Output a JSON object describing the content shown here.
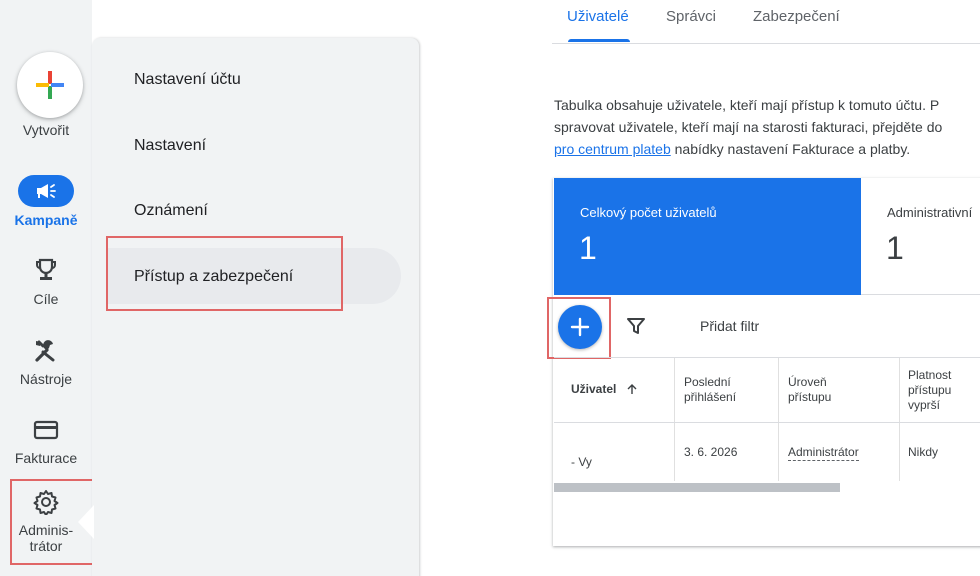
{
  "nav": {
    "create_label": "Vytvořit",
    "items": [
      {
        "label": "Kampaně",
        "icon": "megaphone-icon",
        "active": true
      },
      {
        "label": "Cíle",
        "icon": "trophy-icon"
      },
      {
        "label": "Nástroje",
        "icon": "tools-icon"
      },
      {
        "label": "Fakturace",
        "icon": "credit-card-icon"
      },
      {
        "label": "Adminis-\ntrátor",
        "icon": "gear-icon"
      }
    ]
  },
  "settings_menu": {
    "items": [
      {
        "label": "Nastavení účtu"
      },
      {
        "label": "Nastavení"
      },
      {
        "label": "Oznámení"
      },
      {
        "label": "Přístup a zabezpečení",
        "active": true
      }
    ]
  },
  "tabs": [
    {
      "label": "Uživatelé",
      "active": true
    },
    {
      "label": "Správci"
    },
    {
      "label": "Zabezpečení"
    }
  ],
  "description": {
    "line1": "Tabulka obsahuje uživatele, kteří mají přístup k tomuto účtu. P",
    "line2": "spravovat uživatele, kteří mají na starosti fakturaci, přejděte do",
    "link": "pro centrum plateb",
    "line3_rest": " nabídky nastavení Fakturace a platby."
  },
  "stats": [
    {
      "label": "Celkový počet uživatelů",
      "value": "1"
    },
    {
      "label": "Administrativní",
      "value": "1"
    }
  ],
  "toolbar": {
    "add_filter_label": "Přidat filtr"
  },
  "table": {
    "columns": [
      "Uživatel",
      "Poslední přihlášení",
      "Úroveň přístupu",
      "Platnost přístupu vyprší"
    ],
    "rows": [
      {
        "user": "- Vy",
        "last_login": "3. 6. 2026",
        "access_level": "Administrátor",
        "expires": "Nikdy"
      }
    ]
  },
  "colors": {
    "accent": "#1a73e8",
    "highlight_box": "#e06666",
    "panel_bg": "#f1f3f4"
  }
}
